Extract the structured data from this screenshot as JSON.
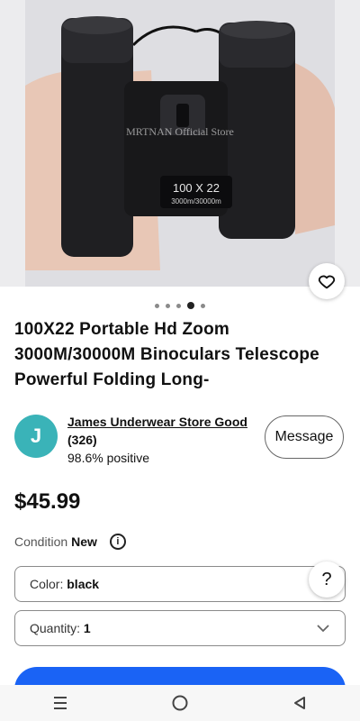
{
  "product": {
    "watermark": "MRTNAN Official Store",
    "model_label": "100 X 22",
    "range_label": "3000m/30000m",
    "title": "100X22 Portable Hd Zoom 3000M/30000M Binoculars Telescope Powerful Folding Long-",
    "price": "$45.99",
    "condition_label": "Condition",
    "condition_value": "New"
  },
  "carousel": {
    "count": 5,
    "active": 3
  },
  "seller": {
    "initial": "J",
    "name": "James Underwear Store Good",
    "feedback_count": "(326)",
    "positive": "98.6% positive",
    "message_label": "Message"
  },
  "options": {
    "color_label": "Color:",
    "color_value": "black",
    "quantity_label": "Quantity:",
    "quantity_value": "1"
  },
  "help": {
    "label": "?"
  },
  "icons": {
    "favorite": "heart-icon",
    "info": "info-icon",
    "chevron": "chevron-down-icon",
    "nav_menu": "menu-icon",
    "nav_home": "home-circle-icon",
    "nav_back": "back-triangle-icon"
  },
  "colors": {
    "avatar": "#3ab3b8",
    "buy_button": "#1a63f5"
  }
}
